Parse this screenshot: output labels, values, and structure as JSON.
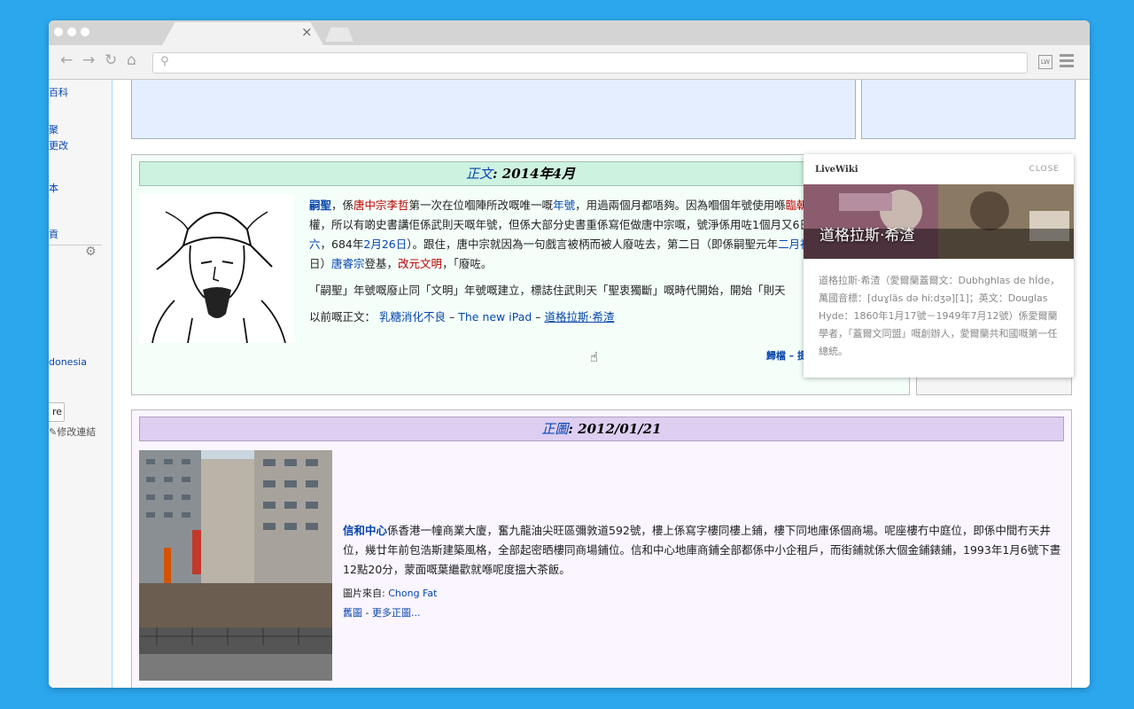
{
  "browser": {
    "tab_close": "×",
    "nav": {
      "back": "←",
      "forward": "→",
      "reload": "↻",
      "home": "⌂"
    },
    "omnibox_icon": "⚲",
    "ext_label": "LW"
  },
  "sidebar": {
    "links": [
      "百科",
      "聚",
      "更改",
      "本",
      "貢"
    ],
    "partial_link": "donesia",
    "button_label": "re",
    "edit_links": "修改連結"
  },
  "featured_article": {
    "header_link": "正文",
    "header_rest": ": 2014年4月",
    "para1": [
      {
        "t": "嗣聖",
        "c": "lk",
        "b": true
      },
      {
        "t": "，係",
        "c": ""
      },
      {
        "t": "唐中宗李哲",
        "c": "rd"
      },
      {
        "t": "第一次在位嗰陣所改嘅唯一嘅",
        "c": ""
      },
      {
        "t": "年號",
        "c": "lk"
      },
      {
        "t": "，用過兩個月都唔夠。因為嗰個年號使用喺",
        "c": ""
      },
      {
        "t": "臨朝稱制",
        "c": "rd"
      },
      {
        "t": "，攞住實際大權，所以有啲史書講佢係武則天嘅年號，但係大部分史書重係寫佢做唐中宗嘅，",
        "c": ""
      },
      {
        "t": "號淨係用咗1個月又6日（嗣聖",
        "c": ""
      },
      {
        "t": "元年",
        "c": "rd"
      },
      {
        "t": "二月初六",
        "c": "lk"
      },
      {
        "t": "，684年",
        "c": ""
      },
      {
        "t": "2月26日",
        "c": "lk"
      },
      {
        "t": "）。跟住，唐中宗就因為一句戲言被",
        "c": ""
      },
      {
        "t": "柄而被人廢咗去，第二日（即係嗣聖元年",
        "c": ""
      },
      {
        "t": "二月初七",
        "c": "lk"
      },
      {
        "t": "，684年2月27日）",
        "c": ""
      },
      {
        "t": "唐睿宗",
        "c": "lk"
      },
      {
        "t": "登基，",
        "c": ""
      },
      {
        "t": "改元文明",
        "c": "rd"
      },
      {
        "t": "，「",
        "c": ""
      },
      {
        "t": "廢咗。",
        "c": ""
      }
    ],
    "para2": "「嗣聖」年號嘅廢止同「文明」年號嘅建立，標誌住武則天「聖衷獨斷」嘅時代開始，開始「則天",
    "prev_label": "以前嘅正文：",
    "prev_links": [
      "乳糖消化不良",
      "The new iPad",
      "道格拉斯·希渣"
    ],
    "prev_sep": " – ",
    "footer": "歸檔 – 提名 – 全部46篇正文..."
  },
  "soundbox": {
    "dash": "-"
  },
  "featured_picture": {
    "header_link": "正圖",
    "header_rest": ": 2012/01/21",
    "lead_link": "信和中心",
    "text": "係香港一幢商業大廈，奮九龍油尖旺區彌敦道592號，樓上係寫字樓同樓上鋪，樓下同地庫係個商場。呢座樓冇中庭位，即係中間冇天井位，幾廿年前包浩斯建築風格，全部起密晒樓同商場鋪位。信和中心地庫商鋪全部都係中小企租戶，而街鋪就係大個金鋪錶鋪，1993年1月6號下晝12點20分，蒙面嘅葉繼歡就喺呢度搵大茶飯。",
    "credit_label": "圖片來自:",
    "credit_name": "Chong Fat",
    "old_link": "舊圖",
    "more_sep": " - ",
    "more_link": "更多正圖..."
  },
  "livewiki": {
    "brand": "LiveWiki",
    "close": "CLOSE",
    "title": "道格拉斯·希渣",
    "body": "道格拉斯·希渣（愛爾蘭蓋爾文：Dubhghlas de hÍde，萬國音標：[duɣläs də hiːdʒə][1]；英文：Douglas Hyde：1860年1月17號－1949年7月12號）係愛爾蘭學者，「蓋爾文同盟」嘅創辦人，愛爾蘭共和國嘅第一任總統。"
  },
  "colors": {
    "background": "#2ba7ee",
    "link": "#0645ad",
    "redlink": "#ba0000",
    "featured_header": "#cef2e0",
    "picture_header": "#ddcef2"
  }
}
